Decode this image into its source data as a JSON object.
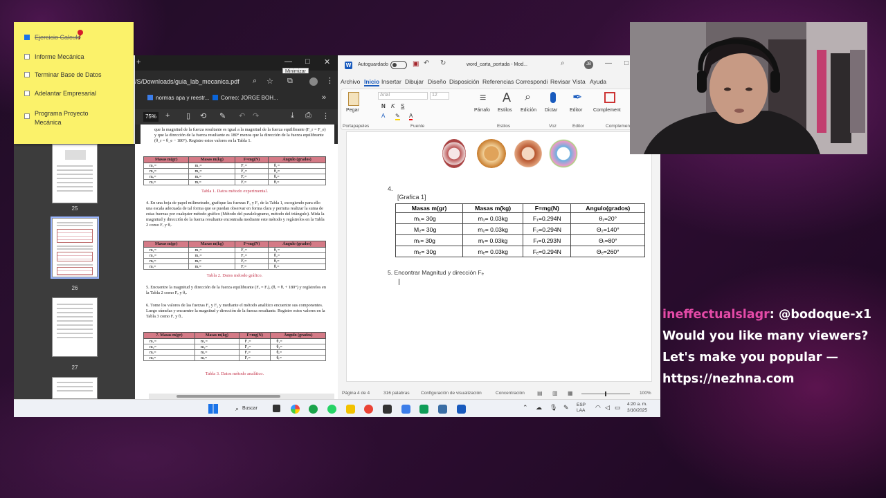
{
  "sticky_note": {
    "tasks": [
      {
        "label": "Ejercicio Calculo",
        "checked": true
      },
      {
        "label": "Informe Mecánica",
        "checked": false
      },
      {
        "label": "Terminar Base de Datos",
        "checked": false
      },
      {
        "label": "Adelantar Empresarial",
        "checked": false
      },
      {
        "label": "Programa Proyecto\nMecánica",
        "checked": false
      }
    ]
  },
  "pdf_viewer": {
    "url": "/S/Downloads/guia_lab_mecanica.pdf",
    "bookmarks": [
      "normas apa y reestr...",
      "Correo: JORGE BOH..."
    ],
    "zoom": "75%",
    "tooltip": "Minimizar",
    "thumb_pages": [
      "25",
      "26",
      "27"
    ],
    "page": {
      "intro_text": "que la magnitud de la fuerza resultante es igual a la magnitud de la fuerza equilibrante (F_r = F_e) y que la dirección de la fuerza resultante es 180° menos que la dirección de la fuerza equilibrante (θ_r = θ_e − 180°). Registre estos valores en la Tabla 1.",
      "table_headers": [
        "Masas m(gr)",
        "Masas m(kg)",
        "F=mg(N)",
        "Ángulo (grados)"
      ],
      "table_rows": [
        [
          "m₁=",
          "m₁=",
          "F₁=",
          "θ₁="
        ],
        [
          "m₂=",
          "m₂=",
          "F₂=",
          "θ₂="
        ],
        [
          "mₑ=",
          "mₑ=",
          "Fₑ=",
          "θₑ="
        ],
        [
          "mᵣ=",
          "mᵣ=",
          "Fᵣ=",
          "θᵣ="
        ]
      ],
      "table1_caption": "Tabla 1. Datos método experimental.",
      "step4_text": "4.  En una hoja de papel milimetrado, grafique las fuerzas F₁ y F₂ de la Tabla 1, escogiendo para ello una escala adecuada de tal forma que se puedan observar en forma clara y permita realizar la suma de estas fuerzas por cualquier método gráfico (Método del paralelogramo, método del triángulo). Mida la magnitud y dirección de la fuerza resultante encontrada mediante este método y regístrelos en la Tabla 2 como Fᵣ y θᵣ.",
      "table2_caption": "Tabla 2. Datos método gráfico.",
      "step5_text": "5.  Encuentre la magnitud y dirección de la fuerza equilibrante (Fₑ = Fᵣ), (θₑ = θᵣ + 180°) y regístrelos en la Tabla 2 como Fₑ y θₑ.",
      "step6_text": "6.  Tome los valores de las fuerzas F₁ y F₂ y mediante el método analítico encuentre sus componentes. Luego súmelas y encuentre la magnitud y dirección de la fuerza resultante. Registre estos valores en la Tabla 3 como Fᵣ y θᵣ.",
      "table3_first_header": "7.  Masas m(gr)",
      "table3_caption": "Tabla 3. Datos método analítico."
    }
  },
  "word": {
    "autosave_label": "Autoguardado",
    "doc_title": "word_carta_portada  -  Mod...",
    "menu": [
      "Archivo",
      "Inicio",
      "Insertar",
      "Dibujar",
      "Diseño",
      "Disposición",
      "Referencias",
      "Correspondi",
      "Revisar",
      "Vista",
      "Ayuda"
    ],
    "active_menu": "Inicio",
    "ribbon": {
      "paste": "Pegar",
      "font_name": "Arial",
      "font_size": "12",
      "buttons": [
        "Párrafo",
        "Estilos",
        "Edición",
        "Dictar",
        "Editor",
        "Complement"
      ],
      "groups": [
        "Portapapeles",
        "Fuente",
        "Estilos",
        "Voz",
        "Editor",
        "Complementos"
      ]
    },
    "doc": {
      "item4": "4.",
      "grafica_label": "[Grafica 1]",
      "table_headers": [
        "Masas m(gr)",
        "Masas m(kg)",
        "F=mg(N)",
        "Angulo(grados)"
      ],
      "table_rows": [
        [
          "m₁= 30g",
          "m₁= 0.03kg",
          "F₁=0.294N",
          "θ₁=20°"
        ],
        [
          "M₂= 30g",
          "m₂= 0.03kg",
          "F₂=0.294N",
          "Θ₂=140°"
        ],
        [
          "mᵣ= 30g",
          "mᵣ= 0.03kg",
          "Fᵣ=0.293N",
          "Θᵣ=80°"
        ],
        [
          "mₑ= 30g",
          "mₑ= 0.03kg",
          "Fₑ=0.294N",
          "Θₑ=260°"
        ]
      ],
      "item5": "5.   Encontrar Magnitud y dirección Fₑ"
    },
    "status": {
      "page": "Página 4 de 4",
      "words": "316 palabras",
      "display_settings": "Configuración de visualización",
      "focus": "Concentración",
      "zoom": "100%"
    }
  },
  "taskbar": {
    "search_label": "Buscar",
    "lang": "ESP\nLAA",
    "time": "4:20 a. m.",
    "date": "3/10/2025",
    "icon_colors": [
      "#1aa34a",
      "#25d366",
      "#f2c200",
      "#ea4335",
      "#333333",
      "#3b7de9",
      "#0f9d58",
      "#3a6ea5",
      "#185abd"
    ]
  },
  "chat": {
    "username": "ineffectualslagr",
    "message": "@bodoque-x1 Would you like many viewers? Let's make you popular — https://nezhna.com"
  }
}
